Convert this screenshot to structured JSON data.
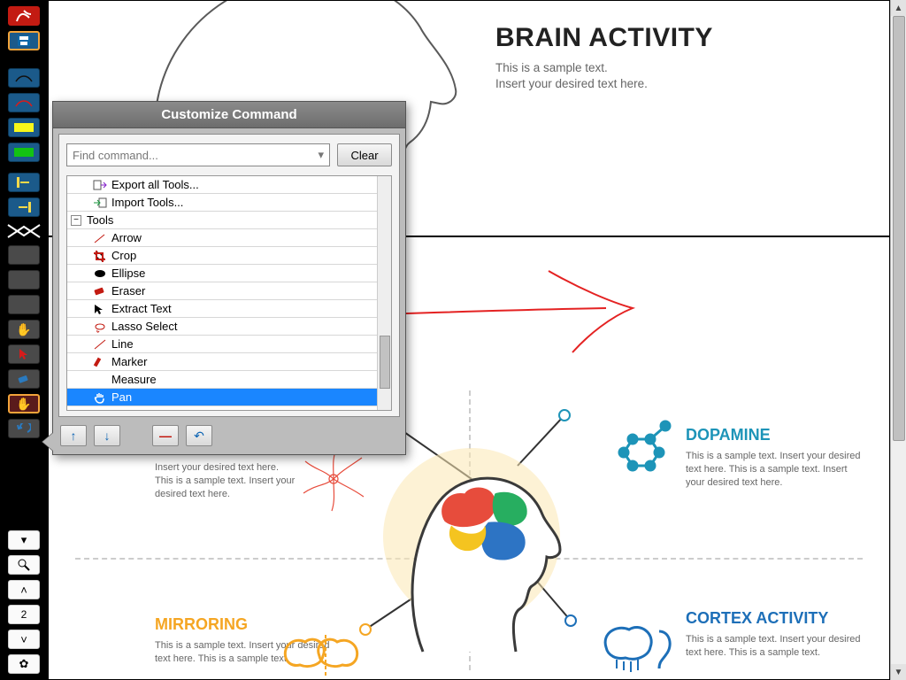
{
  "doc": {
    "title": "BRAIN ACTIVITY",
    "subtitle": "This is a sample text.\nInsert your desired text here.",
    "topics": {
      "dopamine": {
        "heading": "DOPAMINE",
        "body": "This is a sample text. Insert your desired text here. This is a sample text. Insert your desired text here."
      },
      "cortex": {
        "heading": "CORTEX ACTIVITY",
        "body": "This is a sample text. Insert your desired text here. This is a sample text."
      },
      "mirroring": {
        "heading": "MIRRORING",
        "body": "This is a sample text. Insert your desired text here. This is a sample text."
      },
      "upperleft": {
        "body": "Insert your desired text here. This is a sample text. Insert your desired text here."
      }
    },
    "colors": {
      "dopamine": "#1d94b8",
      "cortex": "#1d6fb8",
      "mirroring": "#f5a623"
    }
  },
  "nav": {
    "page_number": "2"
  },
  "dialog": {
    "title": "Customize Command",
    "search_placeholder": "Find command...",
    "clear_label": "Clear",
    "root_items": [
      {
        "label": "Export all Tools...",
        "icon": "export"
      },
      {
        "label": "Import Tools...",
        "icon": "import"
      }
    ],
    "group_label": "Tools",
    "tools": [
      {
        "label": "Arrow",
        "icon": "arrow"
      },
      {
        "label": "Crop",
        "icon": "crop"
      },
      {
        "label": "Ellipse",
        "icon": "ellipse"
      },
      {
        "label": "Eraser",
        "icon": "eraser"
      },
      {
        "label": "Extract Text",
        "icon": "extract"
      },
      {
        "label": "Lasso Select",
        "icon": "lasso"
      },
      {
        "label": "Line",
        "icon": "line"
      },
      {
        "label": "Marker",
        "icon": "marker"
      },
      {
        "label": "Measure",
        "icon": "measure"
      },
      {
        "label": "Pan",
        "icon": "pan",
        "selected": true
      }
    ]
  }
}
